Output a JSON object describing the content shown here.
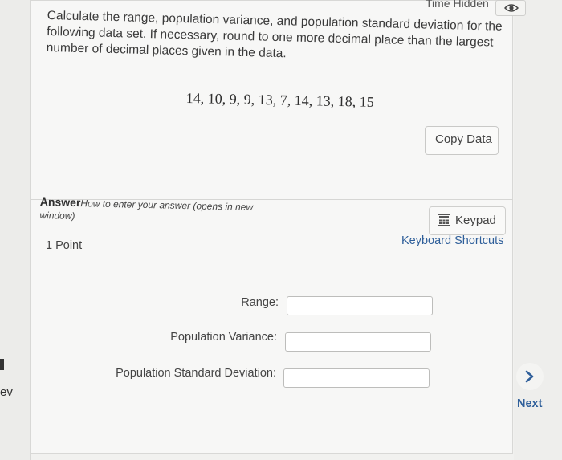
{
  "header": {
    "time_hidden_label": "Time Hidden"
  },
  "question": {
    "text": "Calculate the range, population variance, and population standard deviation for the following data set. If necessary, round to one more decimal place than the largest number of decimal places given in the data.",
    "data_set": "14, 10, 9, 9, 13, 7, 14, 13, 18, 15",
    "copy_data_label": "Copy Data"
  },
  "answer": {
    "label": "Answer",
    "howto_link": "How to enter your answer (opens in new window)",
    "points": "1 Point",
    "keypad_label": "Keypad",
    "keyboard_shortcuts_label": "Keyboard Shortcuts",
    "fields": [
      {
        "label": "Range:",
        "value": ""
      },
      {
        "label": "Population Variance:",
        "value": ""
      },
      {
        "label": "Population Standard Deviation:",
        "value": ""
      }
    ]
  },
  "nav": {
    "prev_label": "ev",
    "next_label": "Next"
  }
}
